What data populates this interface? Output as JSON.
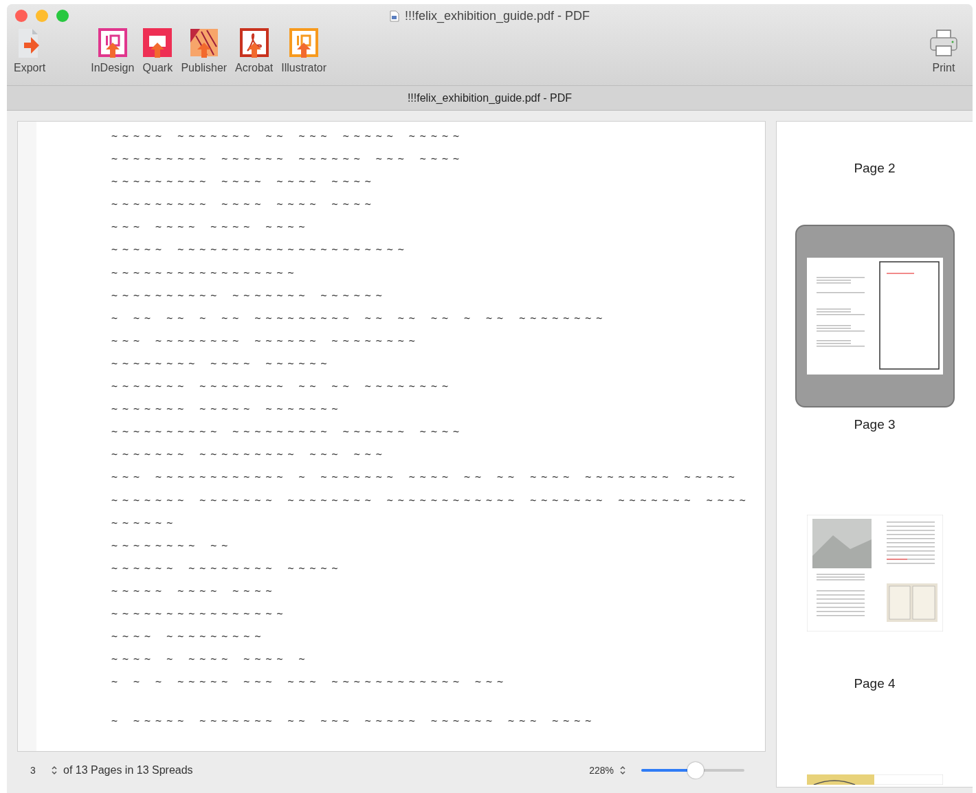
{
  "window": {
    "title": "!!!felix_exhibition_guide.pdf - PDF"
  },
  "toolbar": {
    "items": [
      {
        "label": "Export",
        "kind": "export"
      },
      {
        "label": "InDesign",
        "kind": "indesign"
      },
      {
        "label": "Quark",
        "kind": "quark"
      },
      {
        "label": "Publisher",
        "kind": "publisher"
      },
      {
        "label": "Acrobat",
        "kind": "acrobat"
      },
      {
        "label": "Illustrator",
        "kind": "illustrator"
      }
    ],
    "print": {
      "label": "Print"
    }
  },
  "tab_title": "!!!felix_exhibition_guide.pdf - PDF",
  "document": {
    "paragraphs": [
      [
        "~~~~~ ~~~~~~~ ~~ ~~~ ~~~~~ ~~~~~",
        "~~~~~~~~~ ~~~~~~ ~~~~~~ ~~~ ~~~~",
        "~~~~~~~~~ ~~~~ ~~~~ ~~~~",
        "~~~~~~~~~ ~~~~ ~~~~ ~~~~",
        "~~~ ~~~~ ~~~~ ~~~~",
        "~~~~~ ~~~~~~~~~~~~~~~~~~~~~",
        "~~~~~~~~~~~~~~~~~",
        "~~~~~~~~~~ ~~~~~~~ ~~~~~~",
        "~ ~~ ~~ ~ ~~ ~~~~~~~~~ ~~ ~~ ~~ ~ ~~ ~~~~~~~~",
        "~~~ ~~~~~~~~ ~~~~~~ ~~~~~~~~",
        "~~~~~~~~ ~~~~ ~~~~~~",
        "~~~~~~~ ~~~~~~~~ ~~ ~~ ~~~~~~~~",
        "~~~~~~~ ~~~~~ ~~~~~~~",
        "~~~~~~~~~~ ~~~~~~~~~ ~~~~~~ ~~~~",
        "~~~~~~~ ~~~~~~~~~ ~~~ ~~~",
        "~~~ ~~~~~~~~~~~~ ~ ~~~~~~~ ~~~~ ~~ ~~ ~~~~ ~~~~~~~~ ~~~~~",
        "~~~~~~~ ~~~~~~~ ~~~~~~~~ ~~~~~~~~~~~~ ~~~~~~~ ~~~~~~~ ~~~~",
        "~~~~~~",
        "~~~~~~~~ ~~",
        "~~~~~~ ~~~~~~~~ ~~~~~",
        "~~~~~ ~~~~ ~~~~",
        "~~~~~~~~~~~~~~~~",
        "~~~~ ~~~~~~~~~",
        "~~~~ ~ ~~~~ ~~~~ ~",
        "~ ~ ~ ~~~~~ ~~~ ~~~ ~~~~~~~~~~~~ ~~~"
      ],
      [
        "~ ~~~~~ ~~~~~~~ ~~ ~~~ ~~~~~ ~~~~~~ ~~~ ~~~~"
      ]
    ]
  },
  "sidebar": {
    "thumbnails": [
      {
        "kind": "none",
        "label": "Page 2"
      },
      {
        "kind": "frame_page",
        "label": "Page 3",
        "selected": true
      },
      {
        "kind": "photo_page",
        "label": "Page 4",
        "selected": false
      },
      {
        "kind": "cut_page"
      }
    ]
  },
  "status_bar": {
    "page": "3",
    "pages_text": "of 13 Pages in 13 Spreads",
    "zoom": "228%",
    "zoom_slider": {
      "level": 0.53
    }
  }
}
